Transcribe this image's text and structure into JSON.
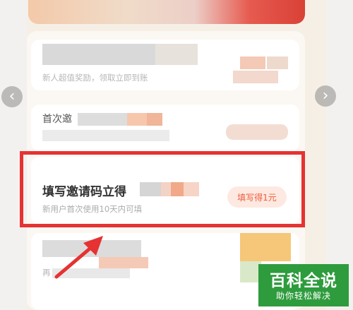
{
  "nav": {
    "prev_icon": "‹",
    "next_icon": "›"
  },
  "cards": [
    {
      "subtitle": "新人超值奖励，领取立即到账"
    },
    {
      "title_fragment": "首次邀"
    },
    {
      "title": "填写邀请码立得",
      "subtitle": "新用户首次使用10天内可填",
      "button_label": "填写得1元"
    },
    {
      "subtitle_fragment": "再"
    }
  ],
  "watermark": {
    "title": "百科全说",
    "subtitle": "助你轻松解决"
  },
  "colors": {
    "highlight": "#e63232",
    "accent": "#ef5d3b",
    "watermark_bg": "#2e9c3d"
  }
}
